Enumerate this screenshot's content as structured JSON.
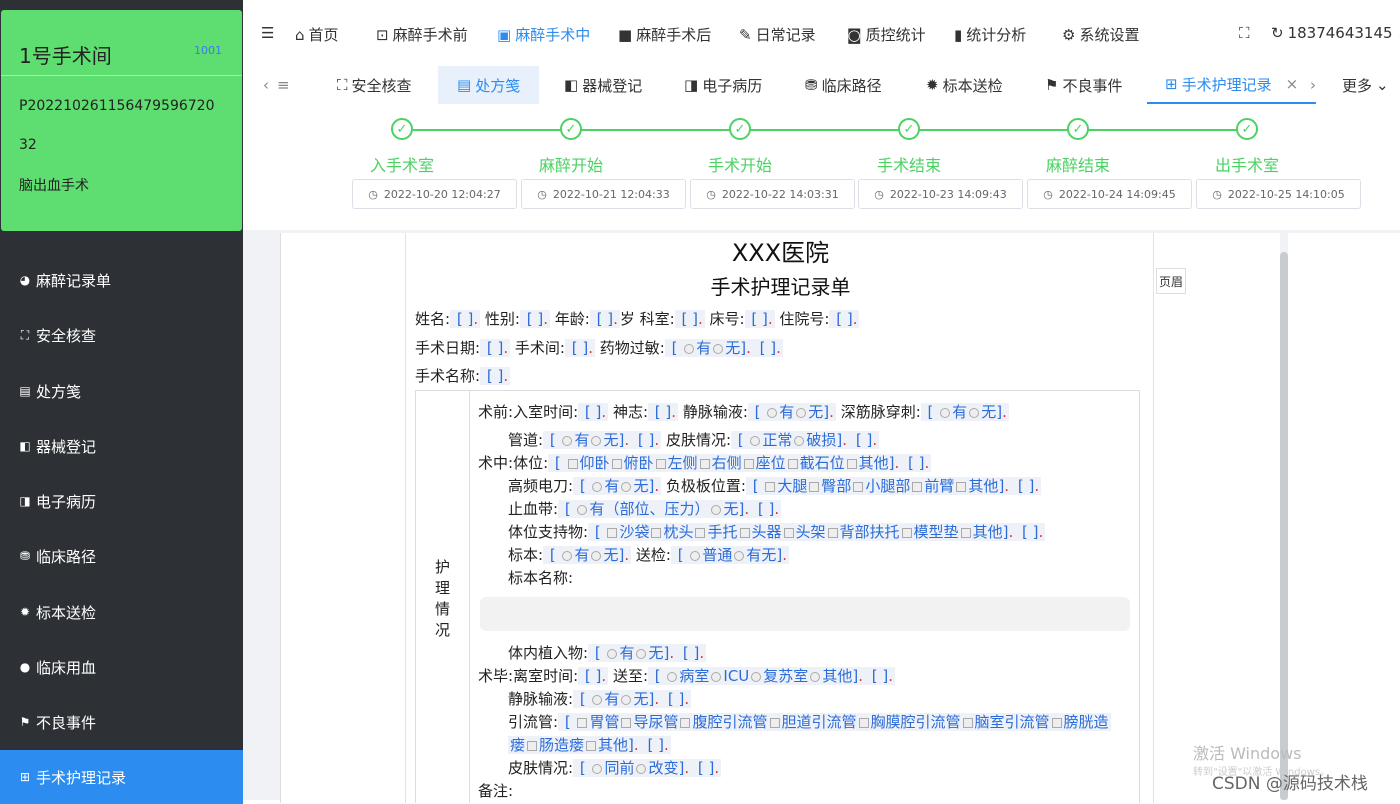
{
  "sidebar": {
    "room_title": "1号手术间",
    "room_code": "1001",
    "patient_id": "P202210261156479596720",
    "patient_num": "32",
    "surgery": "脑出血手术",
    "items": [
      {
        "label": "麻醉记录单",
        "icon": "record-icon"
      },
      {
        "label": "安全核查",
        "icon": "check-icon"
      },
      {
        "label": "处方笺",
        "icon": "prescription-icon"
      },
      {
        "label": "器械登记",
        "icon": "instrument-icon"
      },
      {
        "label": "电子病历",
        "icon": "emr-icon"
      },
      {
        "label": "临床路径",
        "icon": "pathway-icon"
      },
      {
        "label": "标本送检",
        "icon": "specimen-icon"
      },
      {
        "label": "临床用血",
        "icon": "blood-icon"
      },
      {
        "label": "不良事件",
        "icon": "flag-icon"
      },
      {
        "label": "手术护理记录",
        "icon": "nursing-icon"
      }
    ]
  },
  "topnav": {
    "items": [
      "首页",
      "麻醉手术前",
      "麻醉手术中",
      "麻醉手术后",
      "日常记录",
      "质控统计",
      "统计分析",
      "系统设置"
    ],
    "user": "18374643145"
  },
  "tabs": {
    "left_partial": "≡",
    "items": [
      "安全核查",
      "处方笺",
      "器械登记",
      "电子病历",
      "临床路径",
      "标本送检",
      "不良事件",
      "手术护理记录"
    ],
    "close": "×",
    "more": "更多"
  },
  "steps": [
    {
      "label": "入手术室",
      "time": "2022-10-20 12:04:27"
    },
    {
      "label": "麻醉开始",
      "time": "2022-10-21 12:04:33"
    },
    {
      "label": "手术开始",
      "time": "2022-10-22 14:03:31"
    },
    {
      "label": "手术结束",
      "time": "2022-10-23 14:09:43"
    },
    {
      "label": "麻醉结束",
      "time": "2022-10-24 14:09:45"
    },
    {
      "label": "出手术室",
      "time": "2022-10-25 14:10:05"
    }
  ],
  "doc": {
    "hospital": "XXX医院",
    "title": "手术护理记录单",
    "header_btn": "页眉",
    "nursing_label": "护理情况",
    "line1": {
      "name": "姓名:",
      "gender": "性别:",
      "age": "年龄:",
      "age_unit": "岁",
      "dept": "科室:",
      "bed": "床号:",
      "inpatient": "住院号:"
    },
    "line2": {
      "date": "手术日期:",
      "room": "手术间:",
      "allergy": "药物过敏:",
      "yes": "有",
      "no": "无"
    },
    "line3": {
      "name": "手术名称:"
    },
    "pre": {
      "prefix": "术前:",
      "entry": "入室时间:",
      "mind": "神志:",
      "iv": "静脉输液:",
      "deep": "深筋脉穿刺:",
      "tube": "管道:",
      "skin": "皮肤情况:",
      "normal": "正常",
      "broken": "破损"
    },
    "mid": {
      "prefix": "术中:",
      "position": "体位:",
      "pos_opts": [
        "仰卧",
        "俯卧",
        "左侧",
        "右侧",
        "座位",
        "截石位",
        "其他"
      ],
      "hf": "高频电刀:",
      "plate": "负极板位置:",
      "plate_opts": [
        "大腿",
        "臀部",
        "小腿部",
        "前臂",
        "其他"
      ],
      "tourniquet": "止血带:",
      "tourniquet_yes": "有（部位、压力）",
      "support": "体位支持物:",
      "support_opts": [
        "沙袋",
        "枕头",
        "手托",
        "头器",
        "头架",
        "背部扶托",
        "模型垫",
        "其他"
      ],
      "specimen": "标本:",
      "send": "送检:",
      "normal_send": "普通",
      "has_none": "有无",
      "specimen_name": "标本名称:",
      "implant": "体内植入物:"
    },
    "post": {
      "prefix": "术毕:",
      "leave": "离室时间:",
      "to": "送至:",
      "to_opts": [
        "病室",
        "ICU",
        "复苏室",
        "其他"
      ],
      "iv": "静脉输液:",
      "drain": "引流管:",
      "drain_opts": [
        "胃管",
        "导尿管",
        "腹腔引流管",
        "胆道引流管",
        "胸膜腔引流管",
        "脑室引流管",
        "膀胱造"
      ],
      "drain_opts2": [
        "瘘",
        "肠造瘘",
        "其他"
      ],
      "skin": "皮肤情况:",
      "same": "同前",
      "changed": "改变",
      "note": "备注:"
    }
  },
  "watermark": {
    "activate": "激活 Windows",
    "activate_sub": "转到\"设置\"以激活 Windows。",
    "csdn": "CSDN @源码技术栈"
  },
  "colors": {
    "sidebar_bg": "#2d3035",
    "active_blue": "#2c8cf0",
    "room_green": "#5edd70",
    "step_green": "#4bd263"
  }
}
